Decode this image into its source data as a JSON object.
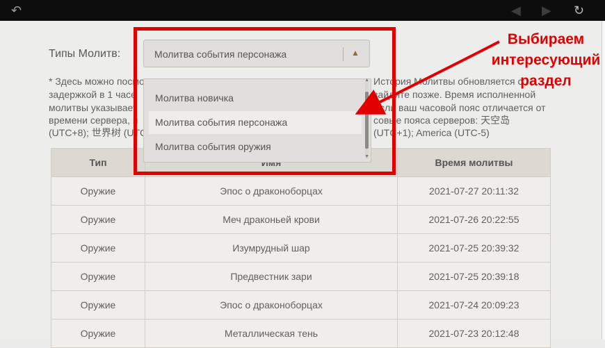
{
  "toolbar": {
    "back_icon": "↶",
    "prev_icon": "◀",
    "next_icon": "▶",
    "refresh_icon": "↻"
  },
  "filter": {
    "label": "Типы Молитв:",
    "selected": "Молитва события персонажа",
    "arrow_icon": "▲",
    "options": [
      "Молитва новичка",
      "Молитва события персонажа",
      "Молитва события оружия"
    ]
  },
  "note": {
    "line1_left": "* Здесь можно посмо",
    "line1_right": "История Молитвы обновляется с",
    "line2_left": "задержкой в 1 часе",
    "line2_right": "зайдите позже. Время исполненной",
    "line3_left": "молитвы указывает",
    "line3_right": "Если ваш часовой пояс отличается от",
    "line4_left": "времени сервера, п",
    "line4_right": "совые пояса серверов: 天空岛",
    "line5_left": "(UTC+8); 世界树 (UTC",
    "line5_right": "(UTC+1); America (UTC-5)"
  },
  "table": {
    "headers": [
      "Тип",
      "Имя",
      "Время молитвы"
    ],
    "rows": [
      [
        "Оружие",
        "Эпос о драконоборцах",
        "2021-07-27 20:11:32"
      ],
      [
        "Оружие",
        "Меч драконьей крови",
        "2021-07-26 20:22:55"
      ],
      [
        "Оружие",
        "Изумрудный шар",
        "2021-07-25 20:39:32"
      ],
      [
        "Оружие",
        "Предвестник зари",
        "2021-07-25 20:39:18"
      ],
      [
        "Оружие",
        "Эпос о драконоборцах",
        "2021-07-24 20:09:23"
      ],
      [
        "Оружие",
        "Металлическая тень",
        "2021-07-23 20:12:48"
      ]
    ]
  },
  "annotation": {
    "line1": "Выбираем",
    "line2": "интересующий",
    "line3": "раздел",
    "color": "#e00000"
  }
}
